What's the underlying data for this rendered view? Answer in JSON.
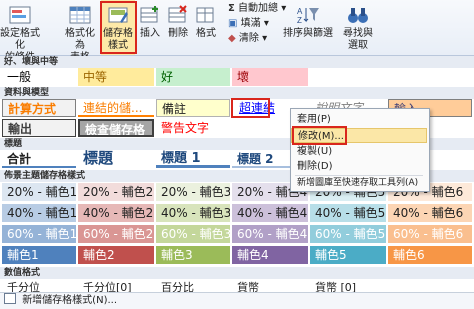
{
  "ribbon": {
    "buttons": [
      {
        "key": "cond",
        "lines": [
          "設定格式化",
          "的條件"
        ],
        "arrow": "▾"
      },
      {
        "key": "table",
        "lines": [
          "格式化為",
          "表格"
        ],
        "arrow": "▾"
      },
      {
        "key": "cellstyle",
        "lines": [
          "儲存格",
          "樣式"
        ],
        "arrow": "▾"
      },
      {
        "key": "insert",
        "lines": [
          "插入",
          ""
        ],
        "arrow": "▾"
      },
      {
        "key": "delete",
        "lines": [
          "刪除",
          ""
        ],
        "arrow": "▾"
      },
      {
        "key": "format",
        "lines": [
          "格式",
          ""
        ],
        "arrow": "▾"
      },
      {
        "key": "sort",
        "lines": [
          "排序與篩選",
          ""
        ],
        "arrow": "▾"
      },
      {
        "key": "find",
        "lines": [
          "尋找與",
          "選取"
        ],
        "arrow": "▾"
      }
    ],
    "small": {
      "autosum": "自動加總",
      "fill": "填滿",
      "clear": "清除"
    }
  },
  "sections": {
    "good_bad": "好、壞與中等",
    "data_model": "資料與模型",
    "titles": "標題",
    "theme": "佈景主題儲存格樣式",
    "number": "數值格式"
  },
  "styles": {
    "row1": [
      "一般",
      "中等",
      "好",
      "壞"
    ],
    "row2": [
      "計算方式",
      "連結的儲...",
      "備註",
      "超連結",
      "說明文字",
      "輸入"
    ],
    "row3": [
      "輸出",
      "檢查儲存格",
      "警告文字"
    ],
    "row4": [
      "合計",
      "標題",
      "標題 1",
      "標題 2"
    ],
    "theme_20": [
      "20% - 輔色1",
      "20% - 輔色2",
      "20% - 輔色3",
      "20% - 輔色4",
      "20% - 輔色5",
      "20% - 輔色6"
    ],
    "theme_40": [
      "40% - 輔色1",
      "40% - 輔色2",
      "40% - 輔色3",
      "40% - 輔色4",
      "40% - 輔色5",
      "40% - 輔色6"
    ],
    "theme_60": [
      "60% - 輔色1",
      "60% - 輔色2",
      "60% - 輔色3",
      "60% - 輔色4",
      "60% - 輔色5",
      "60% - 輔色6"
    ],
    "theme_full": [
      "輔色1",
      "輔色2",
      "輔色3",
      "輔色4",
      "輔色5",
      "輔色6"
    ],
    "number": [
      "千分位",
      "千分位[0]",
      "百分比",
      "貨幣",
      "貨幣 [0]"
    ]
  },
  "context_menu": {
    "items": [
      "套用(P)",
      "修改(M)...",
      "複製(U)",
      "刪除(D)",
      "新增圖庫至快速存取工具列(A)"
    ]
  },
  "footer": {
    "new_style": "新增儲存格樣式(N)..."
  },
  "colors": {
    "highlight_red": "#d9261c",
    "neutral_bg": "#ffeb9c",
    "neutral_fg": "#9c6500",
    "good_bg": "#c6efce",
    "good_fg": "#006100",
    "bad_bg": "#ffc7ce",
    "bad_fg": "#9c0006"
  }
}
